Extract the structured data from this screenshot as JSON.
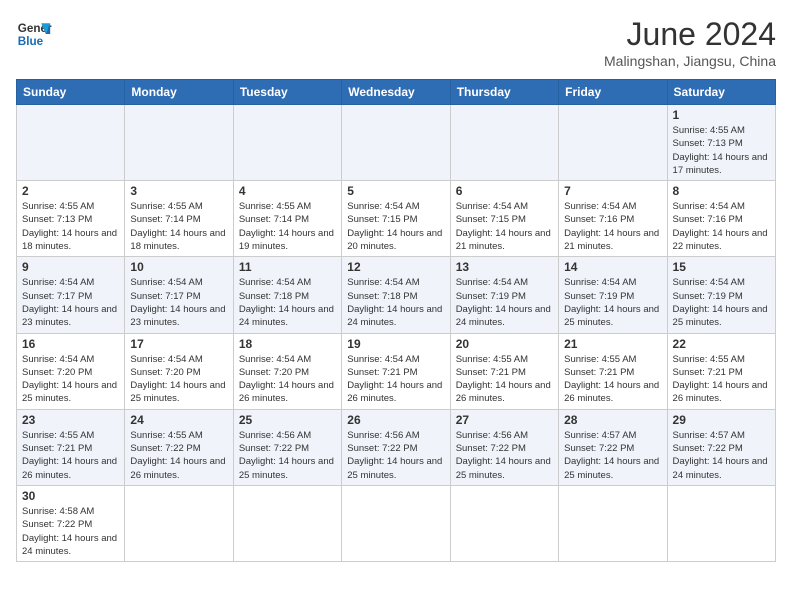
{
  "header": {
    "logo_line1": "General",
    "logo_line2": "Blue",
    "month_year": "June 2024",
    "location": "Malingshan, Jiangsu, China"
  },
  "days_of_week": [
    "Sunday",
    "Monday",
    "Tuesday",
    "Wednesday",
    "Thursday",
    "Friday",
    "Saturday"
  ],
  "weeks": [
    {
      "days": [
        {
          "num": "",
          "info": ""
        },
        {
          "num": "",
          "info": ""
        },
        {
          "num": "",
          "info": ""
        },
        {
          "num": "",
          "info": ""
        },
        {
          "num": "",
          "info": ""
        },
        {
          "num": "",
          "info": ""
        },
        {
          "num": "1",
          "info": "Sunrise: 4:55 AM\nSunset: 7:13 PM\nDaylight: 14 hours and 17 minutes."
        }
      ]
    },
    {
      "days": [
        {
          "num": "2",
          "info": "Sunrise: 4:55 AM\nSunset: 7:13 PM\nDaylight: 14 hours and 18 minutes."
        },
        {
          "num": "3",
          "info": "Sunrise: 4:55 AM\nSunset: 7:14 PM\nDaylight: 14 hours and 18 minutes."
        },
        {
          "num": "4",
          "info": "Sunrise: 4:55 AM\nSunset: 7:14 PM\nDaylight: 14 hours and 19 minutes."
        },
        {
          "num": "5",
          "info": "Sunrise: 4:54 AM\nSunset: 7:15 PM\nDaylight: 14 hours and 20 minutes."
        },
        {
          "num": "6",
          "info": "Sunrise: 4:54 AM\nSunset: 7:15 PM\nDaylight: 14 hours and 21 minutes."
        },
        {
          "num": "7",
          "info": "Sunrise: 4:54 AM\nSunset: 7:16 PM\nDaylight: 14 hours and 21 minutes."
        },
        {
          "num": "8",
          "info": "Sunrise: 4:54 AM\nSunset: 7:16 PM\nDaylight: 14 hours and 22 minutes."
        }
      ]
    },
    {
      "days": [
        {
          "num": "9",
          "info": "Sunrise: 4:54 AM\nSunset: 7:17 PM\nDaylight: 14 hours and 23 minutes."
        },
        {
          "num": "10",
          "info": "Sunrise: 4:54 AM\nSunset: 7:17 PM\nDaylight: 14 hours and 23 minutes."
        },
        {
          "num": "11",
          "info": "Sunrise: 4:54 AM\nSunset: 7:18 PM\nDaylight: 14 hours and 24 minutes."
        },
        {
          "num": "12",
          "info": "Sunrise: 4:54 AM\nSunset: 7:18 PM\nDaylight: 14 hours and 24 minutes."
        },
        {
          "num": "13",
          "info": "Sunrise: 4:54 AM\nSunset: 7:19 PM\nDaylight: 14 hours and 24 minutes."
        },
        {
          "num": "14",
          "info": "Sunrise: 4:54 AM\nSunset: 7:19 PM\nDaylight: 14 hours and 25 minutes."
        },
        {
          "num": "15",
          "info": "Sunrise: 4:54 AM\nSunset: 7:19 PM\nDaylight: 14 hours and 25 minutes."
        }
      ]
    },
    {
      "days": [
        {
          "num": "16",
          "info": "Sunrise: 4:54 AM\nSunset: 7:20 PM\nDaylight: 14 hours and 25 minutes."
        },
        {
          "num": "17",
          "info": "Sunrise: 4:54 AM\nSunset: 7:20 PM\nDaylight: 14 hours and 25 minutes."
        },
        {
          "num": "18",
          "info": "Sunrise: 4:54 AM\nSunset: 7:20 PM\nDaylight: 14 hours and 26 minutes."
        },
        {
          "num": "19",
          "info": "Sunrise: 4:54 AM\nSunset: 7:21 PM\nDaylight: 14 hours and 26 minutes."
        },
        {
          "num": "20",
          "info": "Sunrise: 4:55 AM\nSunset: 7:21 PM\nDaylight: 14 hours and 26 minutes."
        },
        {
          "num": "21",
          "info": "Sunrise: 4:55 AM\nSunset: 7:21 PM\nDaylight: 14 hours and 26 minutes."
        },
        {
          "num": "22",
          "info": "Sunrise: 4:55 AM\nSunset: 7:21 PM\nDaylight: 14 hours and 26 minutes."
        }
      ]
    },
    {
      "days": [
        {
          "num": "23",
          "info": "Sunrise: 4:55 AM\nSunset: 7:21 PM\nDaylight: 14 hours and 26 minutes."
        },
        {
          "num": "24",
          "info": "Sunrise: 4:55 AM\nSunset: 7:22 PM\nDaylight: 14 hours and 26 minutes."
        },
        {
          "num": "25",
          "info": "Sunrise: 4:56 AM\nSunset: 7:22 PM\nDaylight: 14 hours and 25 minutes."
        },
        {
          "num": "26",
          "info": "Sunrise: 4:56 AM\nSunset: 7:22 PM\nDaylight: 14 hours and 25 minutes."
        },
        {
          "num": "27",
          "info": "Sunrise: 4:56 AM\nSunset: 7:22 PM\nDaylight: 14 hours and 25 minutes."
        },
        {
          "num": "28",
          "info": "Sunrise: 4:57 AM\nSunset: 7:22 PM\nDaylight: 14 hours and 25 minutes."
        },
        {
          "num": "29",
          "info": "Sunrise: 4:57 AM\nSunset: 7:22 PM\nDaylight: 14 hours and 24 minutes."
        }
      ]
    },
    {
      "days": [
        {
          "num": "30",
          "info": "Sunrise: 4:58 AM\nSunset: 7:22 PM\nDaylight: 14 hours and 24 minutes."
        },
        {
          "num": "",
          "info": ""
        },
        {
          "num": "",
          "info": ""
        },
        {
          "num": "",
          "info": ""
        },
        {
          "num": "",
          "info": ""
        },
        {
          "num": "",
          "info": ""
        },
        {
          "num": "",
          "info": ""
        }
      ]
    }
  ]
}
